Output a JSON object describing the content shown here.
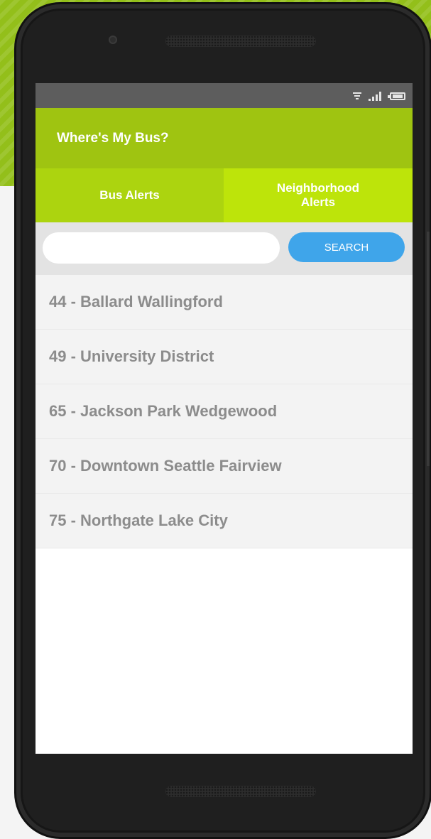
{
  "status_bar": {
    "icons": [
      "wifi-icon",
      "signal-icon",
      "battery-icon"
    ]
  },
  "app": {
    "title": "Where's My Bus?"
  },
  "tabs": [
    {
      "label": "Bus Alerts"
    },
    {
      "label": "Neighborhood Alerts"
    }
  ],
  "search": {
    "value": "",
    "placeholder": "",
    "button_label": "SEARCH"
  },
  "routes": [
    {
      "label": "44 - Ballard Wallingford"
    },
    {
      "label": "49 - University District"
    },
    {
      "label": "65 - Jackson Park Wedgewood"
    },
    {
      "label": "70 - Downtown Seattle Fairview"
    },
    {
      "label": "75 - Northgate Lake City"
    }
  ],
  "colors": {
    "app_bar": "#9fc411",
    "tab_bus": "#acd40f",
    "tab_neighborhood": "#bde40a",
    "search_button": "#3fa5ea",
    "background_green": "#93bf1a"
  }
}
